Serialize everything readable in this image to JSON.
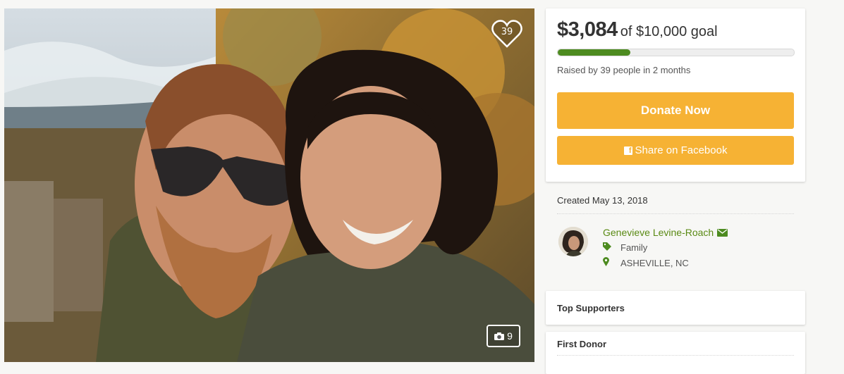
{
  "photo": {
    "alt": "Couple selfie in front of autumn mountains",
    "hearts_count": "39",
    "photos_count": "9",
    "heart_icon": "heart-icon",
    "camera_icon": "camera-icon"
  },
  "donation": {
    "amount": "$3,084",
    "goal": "of $10,000 goal",
    "progress_fraction": 0.3084,
    "raised_text": "Raised by 39 people in 2 months",
    "donate_label": "Donate Now",
    "share_label": "Share on Facebook",
    "accent_color": "#f6b234",
    "progress_color": "#4d8b20"
  },
  "campaign": {
    "created": "Created May 13, 2018",
    "organizer": "Genevieve Levine-Roach",
    "category": "Family",
    "location": "ASHEVILLE, NC"
  },
  "sections": {
    "top_supporters": "Top Supporters",
    "first_donor": "First Donor"
  }
}
